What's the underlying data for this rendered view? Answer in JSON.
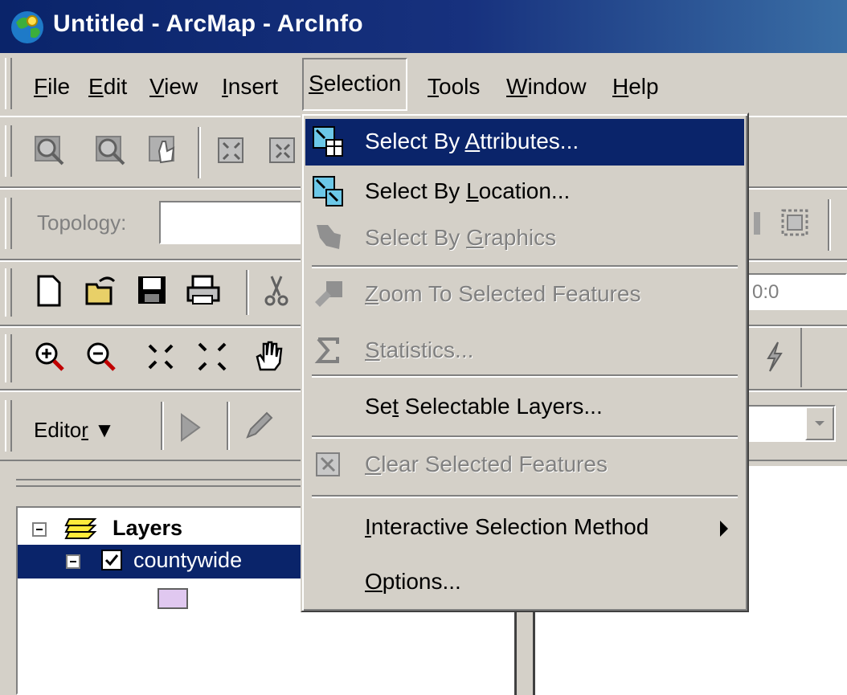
{
  "window": {
    "title": "Untitled - ArcMap - ArcInfo"
  },
  "menubar": {
    "items": [
      {
        "label_pre": "",
        "accel": "F",
        "label_post": "ile"
      },
      {
        "label_pre": "",
        "accel": "E",
        "label_post": "dit"
      },
      {
        "label_pre": "",
        "accel": "V",
        "label_post": "iew"
      },
      {
        "label_pre": "",
        "accel": "I",
        "label_post": "nsert"
      },
      {
        "label_pre": "",
        "accel": "S",
        "label_post": "election"
      },
      {
        "label_pre": "",
        "accel": "T",
        "label_post": "ools"
      },
      {
        "label_pre": "",
        "accel": "W",
        "label_post": "indow"
      },
      {
        "label_pre": "",
        "accel": "H",
        "label_post": "elp"
      }
    ]
  },
  "topology": {
    "label": "Topology:"
  },
  "coords": {
    "value": "0:0"
  },
  "editor": {
    "pre": "Edito",
    "accel": "r"
  },
  "selection_menu": {
    "items": [
      {
        "pre": "Select By ",
        "accel": "A",
        "post": "ttributes...",
        "state": "highlighted"
      },
      {
        "pre": "Select By ",
        "accel": "L",
        "post": "ocation...",
        "state": "enabled"
      },
      {
        "pre": "Select By ",
        "accel": "G",
        "post": "raphics",
        "state": "disabled"
      },
      {
        "pre": "",
        "accel": "Z",
        "post": "oom To Selected Features",
        "state": "disabled"
      },
      {
        "pre": "",
        "accel": "S",
        "post": "tatistics...",
        "state": "disabled"
      },
      {
        "pre": "Se",
        "accel": "t",
        "post": " Selectable Layers...",
        "state": "enabled"
      },
      {
        "pre": "",
        "accel": "C",
        "post": "lear Selected Features",
        "state": "disabled"
      },
      {
        "pre": "",
        "accel": "I",
        "post": "nteractive Selection Method",
        "state": "enabled"
      },
      {
        "pre": "",
        "accel": "O",
        "post": "ptions...",
        "state": "enabled"
      }
    ]
  },
  "toc": {
    "root_label": "Layers",
    "layer_label": "countywide",
    "layer_checked": true,
    "symbol_color": "#e0c8f0"
  },
  "colors": {
    "title_bar": "#0a246a",
    "highlight": "#0a246a",
    "face": "#d4d0c8"
  }
}
